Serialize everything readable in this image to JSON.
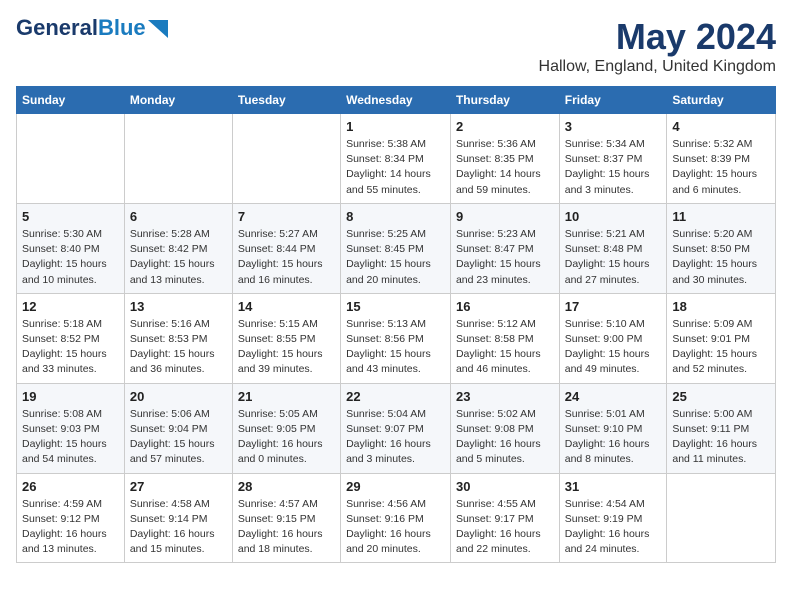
{
  "logo": {
    "line1": "General",
    "line2": "Blue"
  },
  "header": {
    "month": "May 2024",
    "location": "Hallow, England, United Kingdom"
  },
  "days_of_week": [
    "Sunday",
    "Monday",
    "Tuesday",
    "Wednesday",
    "Thursday",
    "Friday",
    "Saturday"
  ],
  "weeks": [
    [
      {
        "day": "",
        "info": ""
      },
      {
        "day": "",
        "info": ""
      },
      {
        "day": "",
        "info": ""
      },
      {
        "day": "1",
        "info": "Sunrise: 5:38 AM\nSunset: 8:34 PM\nDaylight: 14 hours\nand 55 minutes."
      },
      {
        "day": "2",
        "info": "Sunrise: 5:36 AM\nSunset: 8:35 PM\nDaylight: 14 hours\nand 59 minutes."
      },
      {
        "day": "3",
        "info": "Sunrise: 5:34 AM\nSunset: 8:37 PM\nDaylight: 15 hours\nand 3 minutes."
      },
      {
        "day": "4",
        "info": "Sunrise: 5:32 AM\nSunset: 8:39 PM\nDaylight: 15 hours\nand 6 minutes."
      }
    ],
    [
      {
        "day": "5",
        "info": "Sunrise: 5:30 AM\nSunset: 8:40 PM\nDaylight: 15 hours\nand 10 minutes."
      },
      {
        "day": "6",
        "info": "Sunrise: 5:28 AM\nSunset: 8:42 PM\nDaylight: 15 hours\nand 13 minutes."
      },
      {
        "day": "7",
        "info": "Sunrise: 5:27 AM\nSunset: 8:44 PM\nDaylight: 15 hours\nand 16 minutes."
      },
      {
        "day": "8",
        "info": "Sunrise: 5:25 AM\nSunset: 8:45 PM\nDaylight: 15 hours\nand 20 minutes."
      },
      {
        "day": "9",
        "info": "Sunrise: 5:23 AM\nSunset: 8:47 PM\nDaylight: 15 hours\nand 23 minutes."
      },
      {
        "day": "10",
        "info": "Sunrise: 5:21 AM\nSunset: 8:48 PM\nDaylight: 15 hours\nand 27 minutes."
      },
      {
        "day": "11",
        "info": "Sunrise: 5:20 AM\nSunset: 8:50 PM\nDaylight: 15 hours\nand 30 minutes."
      }
    ],
    [
      {
        "day": "12",
        "info": "Sunrise: 5:18 AM\nSunset: 8:52 PM\nDaylight: 15 hours\nand 33 minutes."
      },
      {
        "day": "13",
        "info": "Sunrise: 5:16 AM\nSunset: 8:53 PM\nDaylight: 15 hours\nand 36 minutes."
      },
      {
        "day": "14",
        "info": "Sunrise: 5:15 AM\nSunset: 8:55 PM\nDaylight: 15 hours\nand 39 minutes."
      },
      {
        "day": "15",
        "info": "Sunrise: 5:13 AM\nSunset: 8:56 PM\nDaylight: 15 hours\nand 43 minutes."
      },
      {
        "day": "16",
        "info": "Sunrise: 5:12 AM\nSunset: 8:58 PM\nDaylight: 15 hours\nand 46 minutes."
      },
      {
        "day": "17",
        "info": "Sunrise: 5:10 AM\nSunset: 9:00 PM\nDaylight: 15 hours\nand 49 minutes."
      },
      {
        "day": "18",
        "info": "Sunrise: 5:09 AM\nSunset: 9:01 PM\nDaylight: 15 hours\nand 52 minutes."
      }
    ],
    [
      {
        "day": "19",
        "info": "Sunrise: 5:08 AM\nSunset: 9:03 PM\nDaylight: 15 hours\nand 54 minutes."
      },
      {
        "day": "20",
        "info": "Sunrise: 5:06 AM\nSunset: 9:04 PM\nDaylight: 15 hours\nand 57 minutes."
      },
      {
        "day": "21",
        "info": "Sunrise: 5:05 AM\nSunset: 9:05 PM\nDaylight: 16 hours\nand 0 minutes."
      },
      {
        "day": "22",
        "info": "Sunrise: 5:04 AM\nSunset: 9:07 PM\nDaylight: 16 hours\nand 3 minutes."
      },
      {
        "day": "23",
        "info": "Sunrise: 5:02 AM\nSunset: 9:08 PM\nDaylight: 16 hours\nand 5 minutes."
      },
      {
        "day": "24",
        "info": "Sunrise: 5:01 AM\nSunset: 9:10 PM\nDaylight: 16 hours\nand 8 minutes."
      },
      {
        "day": "25",
        "info": "Sunrise: 5:00 AM\nSunset: 9:11 PM\nDaylight: 16 hours\nand 11 minutes."
      }
    ],
    [
      {
        "day": "26",
        "info": "Sunrise: 4:59 AM\nSunset: 9:12 PM\nDaylight: 16 hours\nand 13 minutes."
      },
      {
        "day": "27",
        "info": "Sunrise: 4:58 AM\nSunset: 9:14 PM\nDaylight: 16 hours\nand 15 minutes."
      },
      {
        "day": "28",
        "info": "Sunrise: 4:57 AM\nSunset: 9:15 PM\nDaylight: 16 hours\nand 18 minutes."
      },
      {
        "day": "29",
        "info": "Sunrise: 4:56 AM\nSunset: 9:16 PM\nDaylight: 16 hours\nand 20 minutes."
      },
      {
        "day": "30",
        "info": "Sunrise: 4:55 AM\nSunset: 9:17 PM\nDaylight: 16 hours\nand 22 minutes."
      },
      {
        "day": "31",
        "info": "Sunrise: 4:54 AM\nSunset: 9:19 PM\nDaylight: 16 hours\nand 24 minutes."
      },
      {
        "day": "",
        "info": ""
      }
    ]
  ]
}
